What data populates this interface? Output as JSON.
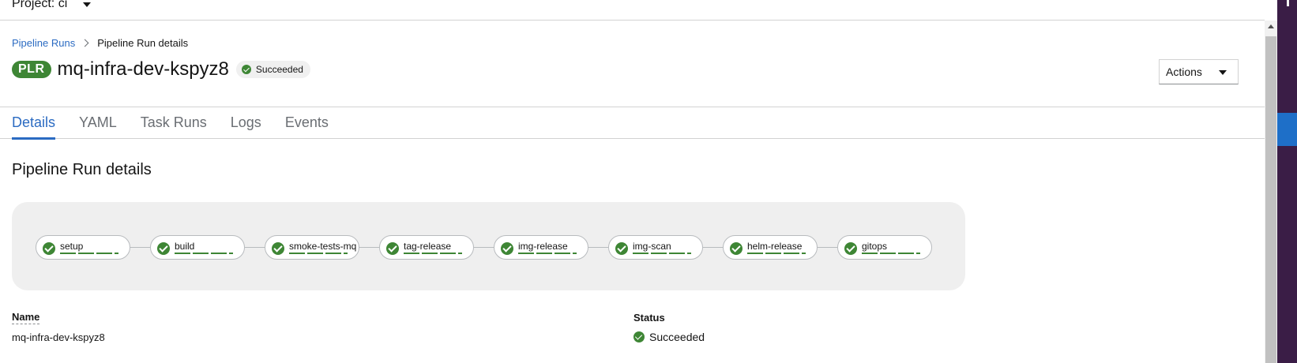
{
  "project": {
    "label": "Project: ci"
  },
  "breadcrumb": {
    "link": "Pipeline Runs",
    "current": "Pipeline Run details"
  },
  "header": {
    "badge": "PLR",
    "title": "mq-infra-dev-kspyz8",
    "status": "Succeeded",
    "actions_label": "Actions"
  },
  "tabs": [
    "Details",
    "YAML",
    "Task Runs",
    "Logs",
    "Events"
  ],
  "active_tab": "Details",
  "section_title": "Pipeline Run details",
  "pipeline": {
    "tasks": [
      {
        "name": "setup",
        "status": "succeeded"
      },
      {
        "name": "build",
        "status": "succeeded"
      },
      {
        "name": "smoke-tests-mq",
        "status": "succeeded"
      },
      {
        "name": "tag-release",
        "status": "succeeded"
      },
      {
        "name": "img-release",
        "status": "succeeded"
      },
      {
        "name": "img-scan",
        "status": "succeeded"
      },
      {
        "name": "helm-release",
        "status": "succeeded"
      },
      {
        "name": "gitops",
        "status": "succeeded"
      }
    ]
  },
  "details": {
    "name_label": "Name",
    "name_value": "mq-infra-dev-kspyz8",
    "status_label": "Status",
    "status_value": "Succeeded"
  },
  "colors": {
    "success": "#3e8635",
    "link": "#2b6bc2",
    "side_strip": "#3a1d46",
    "side_accent": "#1e6fc8"
  },
  "icons": {
    "status": "check-circle-icon",
    "dropdown": "caret-down-icon",
    "breadcrumb_separator": "chevron-right-icon"
  }
}
